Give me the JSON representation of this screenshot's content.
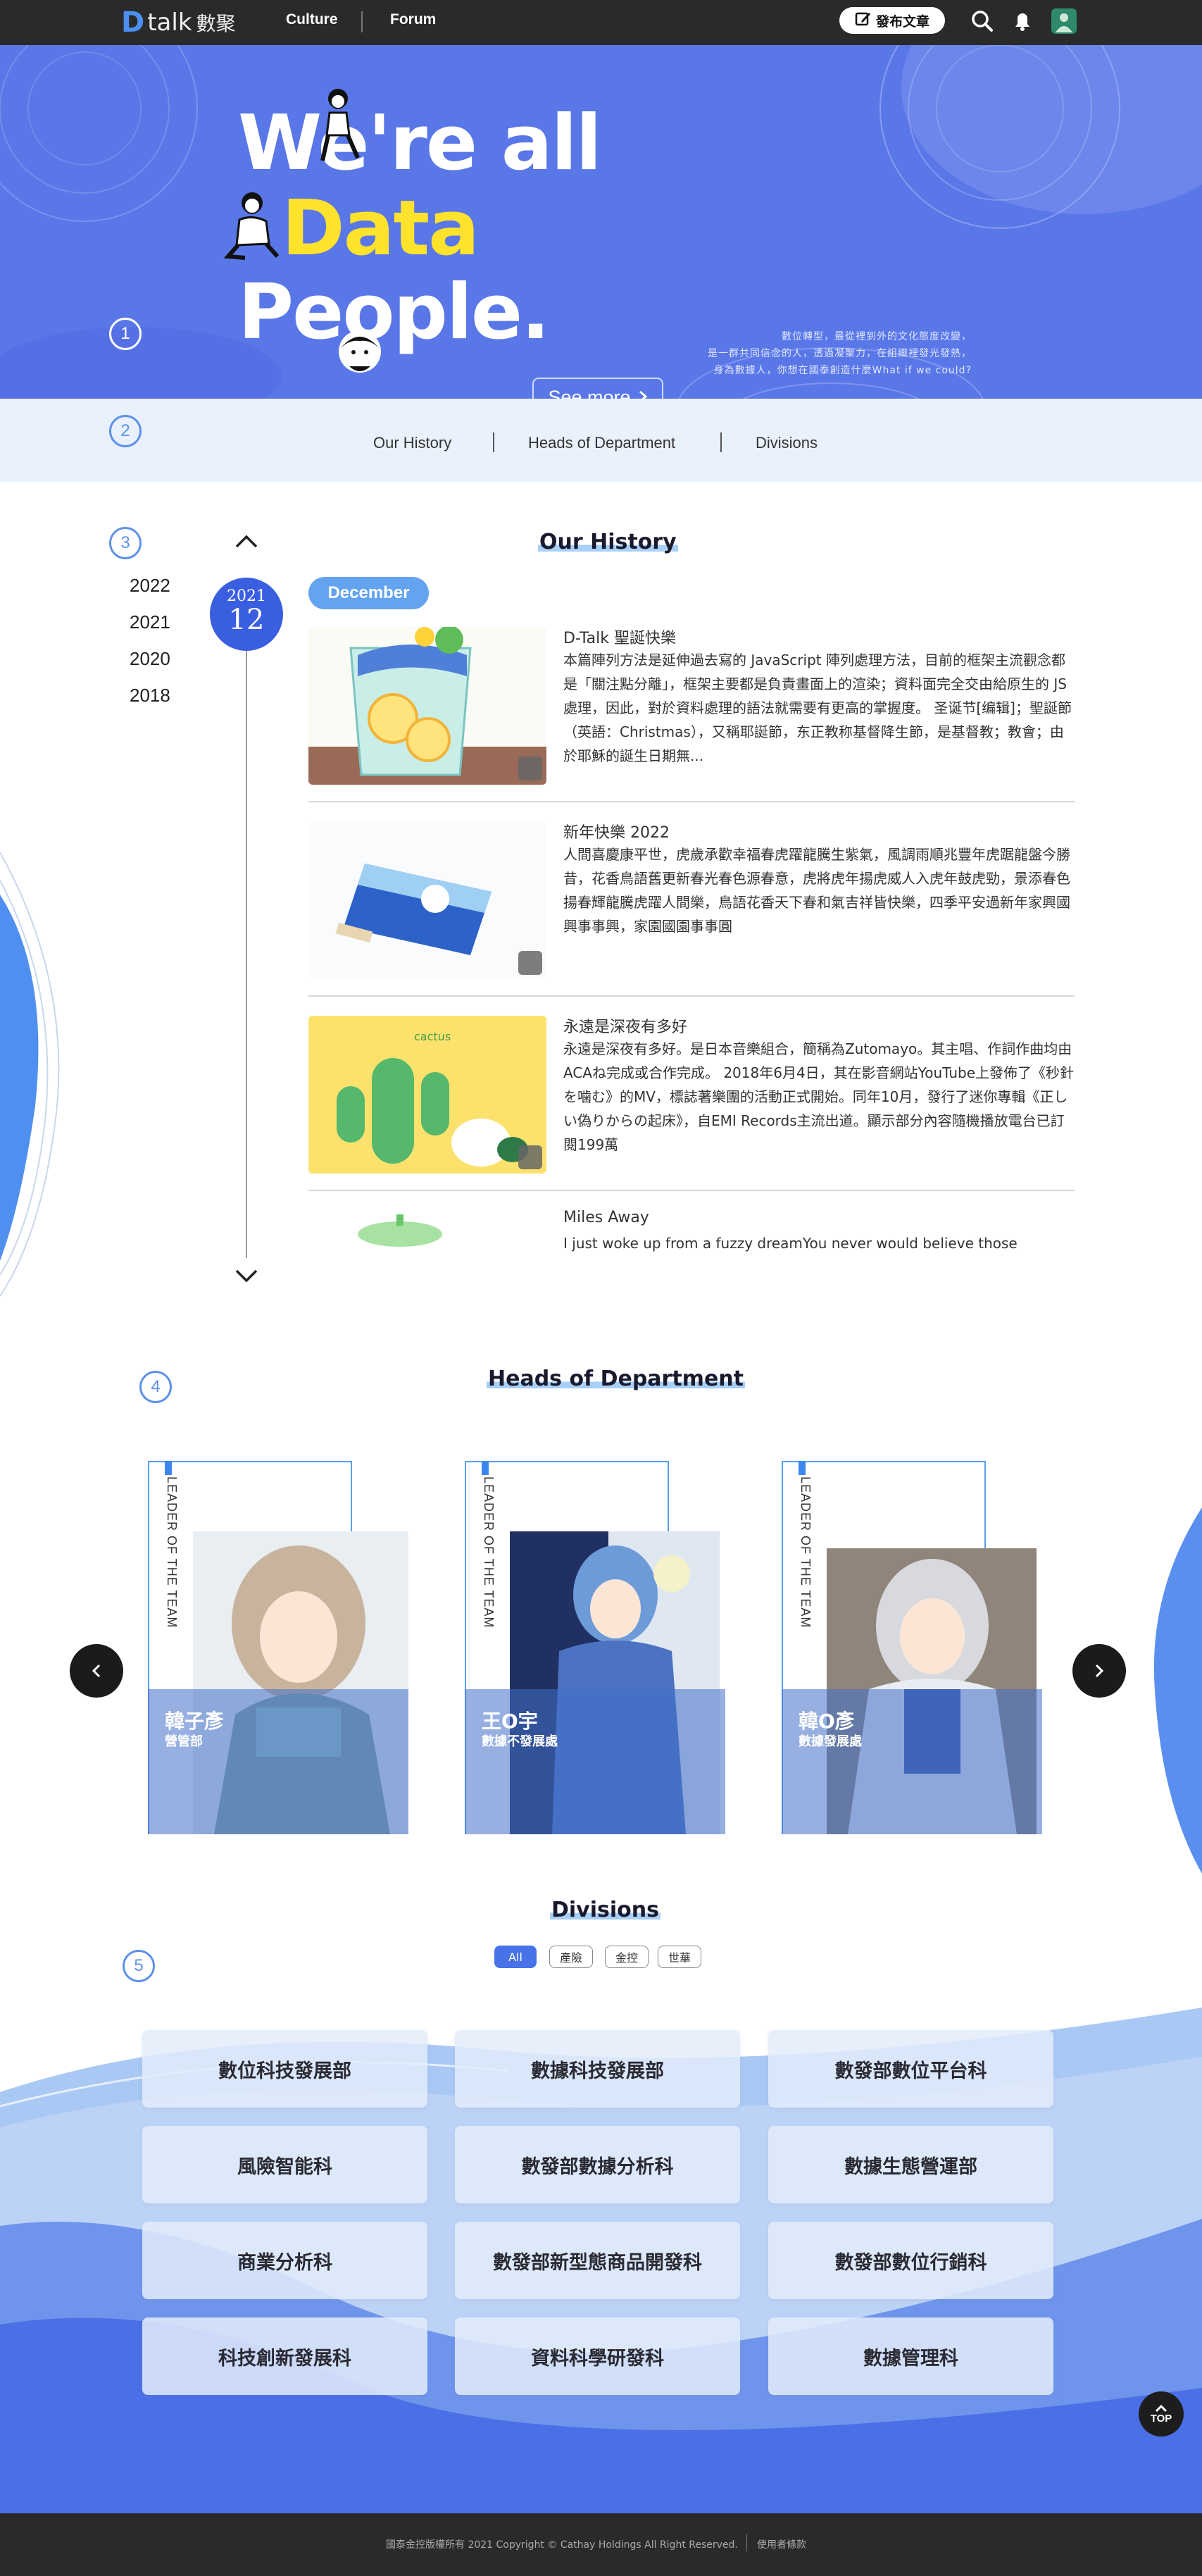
{
  "header": {
    "logo_mark": "D",
    "logo_text": "talk",
    "logo_cn": "數聚",
    "nav": [
      "Culture",
      "Forum"
    ],
    "publish_label": "發布文章",
    "icons": [
      "search-icon",
      "bell-icon",
      "user-avatar-icon"
    ]
  },
  "hero": {
    "line1": "We're all",
    "line2": "Data",
    "line3": "People.",
    "tagline": [
      "數位轉型，最從裡到外的文化態度改變，",
      "是一群共同信念的人，透過凝聚力，在組織裡發光發熱，",
      "身為數據人，你想在國泰創造什麼What if we could?"
    ],
    "see_more": "See more",
    "step": "1"
  },
  "subnav": {
    "step": "2",
    "links": [
      "Our History",
      "Heads of Department",
      "Divisions"
    ]
  },
  "history": {
    "step": "3",
    "title": "Our History",
    "years": [
      "2022",
      "2021",
      "2020",
      "2018"
    ],
    "active_year": "2022",
    "date_year": "2021",
    "date_day": "12",
    "month": "December",
    "items": [
      {
        "title": "D-Talk 聖誕快樂",
        "body": "本篇陣列方法是延伸過去寫的 JavaScript 陣列處理方法，目前的框架主流觀念都是「關注點分離」，框架主要都是負責畫面上的渲染；資料面完全交由給原生的 JS 處理，因此，對於資料處理的語法就需要有更高的掌握度。 圣诞节[编辑]；聖誕節（英語：Christmas），又稱耶誕節，东正教称基督降生節，是基督教；教會；由於耶穌的誕生日期無..."
      },
      {
        "title": "新年快樂 2022",
        "body": "人間喜慶康平世，虎歲承歡幸福春虎躍龍騰生紫氣，風調雨順兆豐年虎踞龍盤今勝昔，花香鳥語舊更新春光春色源春意，虎將虎年揚虎威人入虎年鼓虎勁，景添春色揚春輝龍騰虎躍人間樂，鳥語花香天下春和氣吉祥皆快樂，四季平安過新年家興國興事事興，家園國園事事圓"
      },
      {
        "title": "永遠是深夜有多好",
        "body": "永遠是深夜有多好。是日本音樂組合，簡稱為Zutomayo。其主唱、作詞作曲均由ACAね完成或合作完成。 2018年6月4日，其在影音網站YouTube上發佈了《秒針を噛む》的MV，標誌著樂團的活動正式開始。同年10月，發行了迷你專輯《正しい偽りからの起床》，自EMI Records主流出道。顯示部分內容隨機播放電台已訂閱199萬"
      },
      {
        "title": "Miles Away",
        "body": "I just woke up from a fuzzy dreamYou never would believe those"
      }
    ],
    "thumb_labels": [
      "cactus"
    ]
  },
  "heads": {
    "step": "4",
    "title": "Heads of Department",
    "leader_label": "LEADER OF THE TEAM",
    "cards": [
      {
        "name": "韓子彥",
        "dept": "營管部"
      },
      {
        "name": "王O宇",
        "dept": "數據不發展處"
      },
      {
        "name": "韓O彥",
        "dept": "數據發展處"
      }
    ]
  },
  "divisions": {
    "step": "5",
    "title": "Divisions",
    "filters": [
      "All",
      "產險",
      "金控",
      "世華"
    ],
    "active_filter": "All",
    "items": [
      "數位科技發展部",
      "數據科技發展部",
      "數發部數位平台科",
      "風險智能科",
      "數發部數據分析科",
      "數據生態營運部",
      "商業分析科",
      "數發部新型態商品開發科",
      "數發部數位行銷科",
      "科技創新發展科",
      "資料科學研發科",
      "數據管理科"
    ]
  },
  "top_button": "TOP",
  "footer": {
    "copyright": "國泰金控版權所有 2021 Copyright © Cathay Holdings All Right Reserved.",
    "terms": "使用者條款"
  },
  "colors": {
    "header_bg": "#2a2a2a",
    "hero_bg": "#5a77e8",
    "accent": "#3a5ee0",
    "headline_yellow": "#ffe22b",
    "subnav_bg": "#e9f1fd"
  }
}
